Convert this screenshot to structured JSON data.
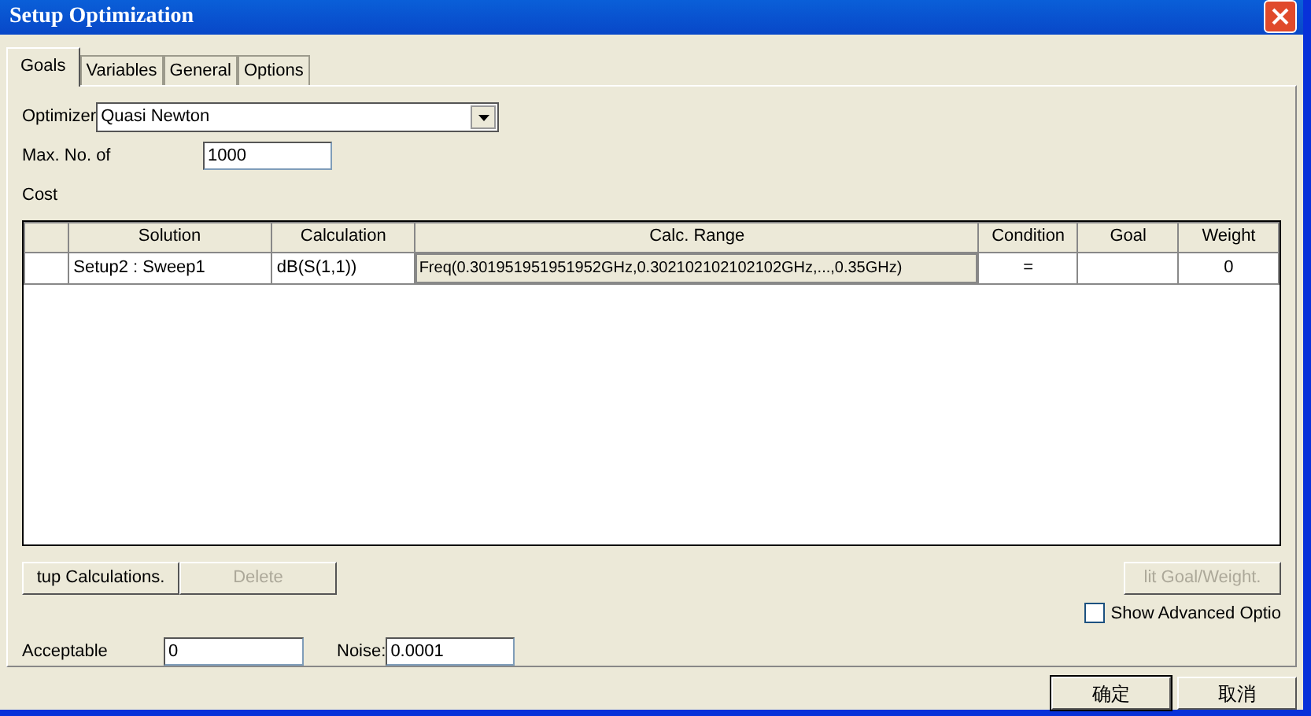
{
  "window": {
    "title": "Setup Optimization"
  },
  "tabs": [
    {
      "label": "Goals",
      "selected": true
    },
    {
      "label": "Variables",
      "selected": false
    },
    {
      "label": "General",
      "selected": false
    },
    {
      "label": "Options",
      "selected": false
    }
  ],
  "optimizer": {
    "label": "Optimizer",
    "value": "Quasi Newton"
  },
  "max_iterations": {
    "label": "Max. No. of",
    "value": "1000"
  },
  "cost_label": "Cost",
  "table": {
    "columns": [
      "Solution",
      "Calculation",
      "Calc. Range",
      "Condition",
      "Goal",
      "Weight"
    ],
    "rows": [
      {
        "cells": [
          "Setup2 : Sweep1",
          "dB(S(1,1))",
          "Freq(0.301951951951952GHz,0.302102102102102GHz,...,0.35GHz)",
          "=",
          "",
          "0"
        ]
      }
    ]
  },
  "table_buttons": [
    {
      "label": "tup Calculations.",
      "disabled": false
    },
    {
      "label": "Delete",
      "disabled": true
    },
    {
      "label": "lit Goal/Weight.",
      "disabled": true
    }
  ],
  "acceptable": {
    "label": "Acceptable",
    "value": "0"
  },
  "noise": {
    "label": "Noise:",
    "value": "0.0001"
  },
  "show_advanced": {
    "label": "Show Advanced Optio",
    "checked": false
  },
  "dialog_buttons": [
    {
      "label": "确定",
      "default": true
    },
    {
      "label": "取消",
      "default": false
    }
  ]
}
